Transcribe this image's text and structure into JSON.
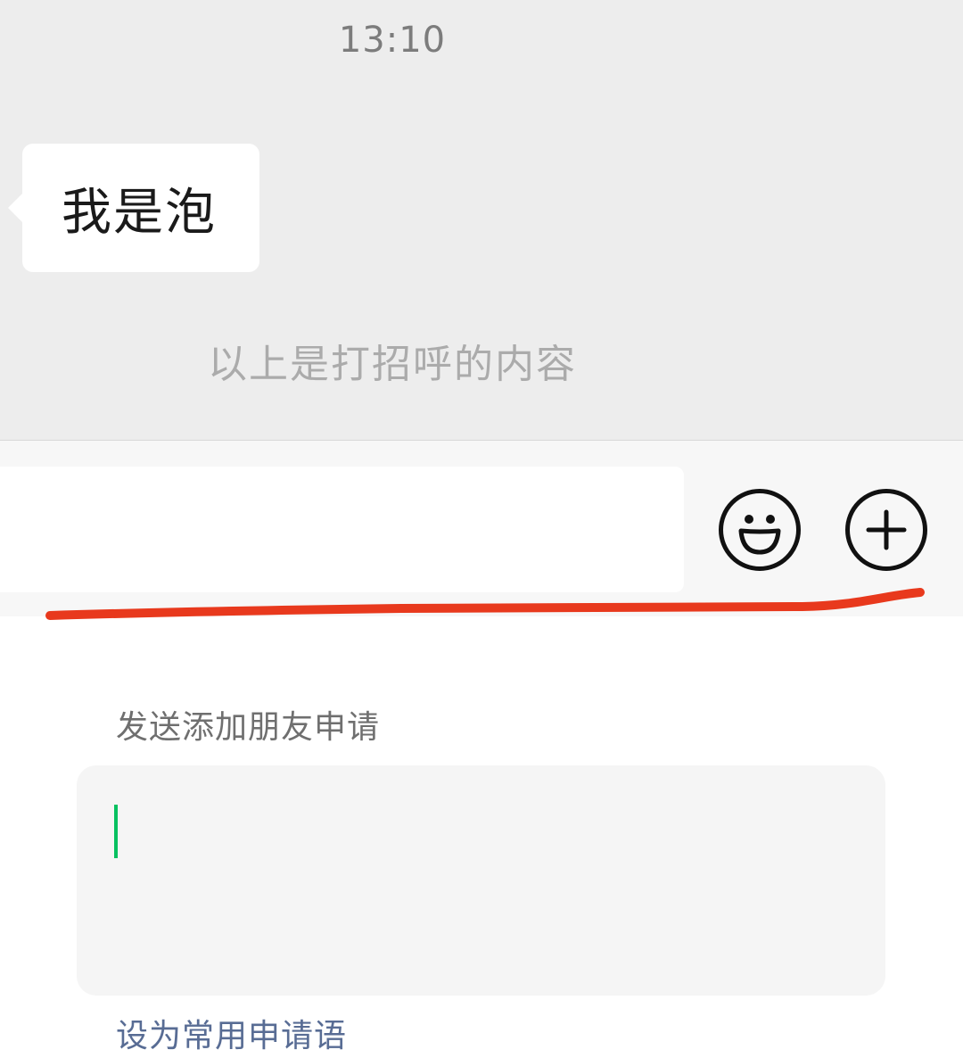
{
  "chat": {
    "timestamp": "13:10",
    "message": "我是泡",
    "system_note": "以上是打招呼的内容"
  },
  "input_bar": {
    "placeholder": "",
    "emoji_icon": "smiley-face-icon",
    "plus_icon": "plus-circle-icon"
  },
  "friend_request": {
    "title": "发送添加朋友申请",
    "value": "",
    "set_common_label": "设为常用申请语"
  },
  "colors": {
    "chat_background": "#ededed",
    "cursor": "#07c160",
    "link": "#586c94",
    "annotation": "#e8391d"
  }
}
